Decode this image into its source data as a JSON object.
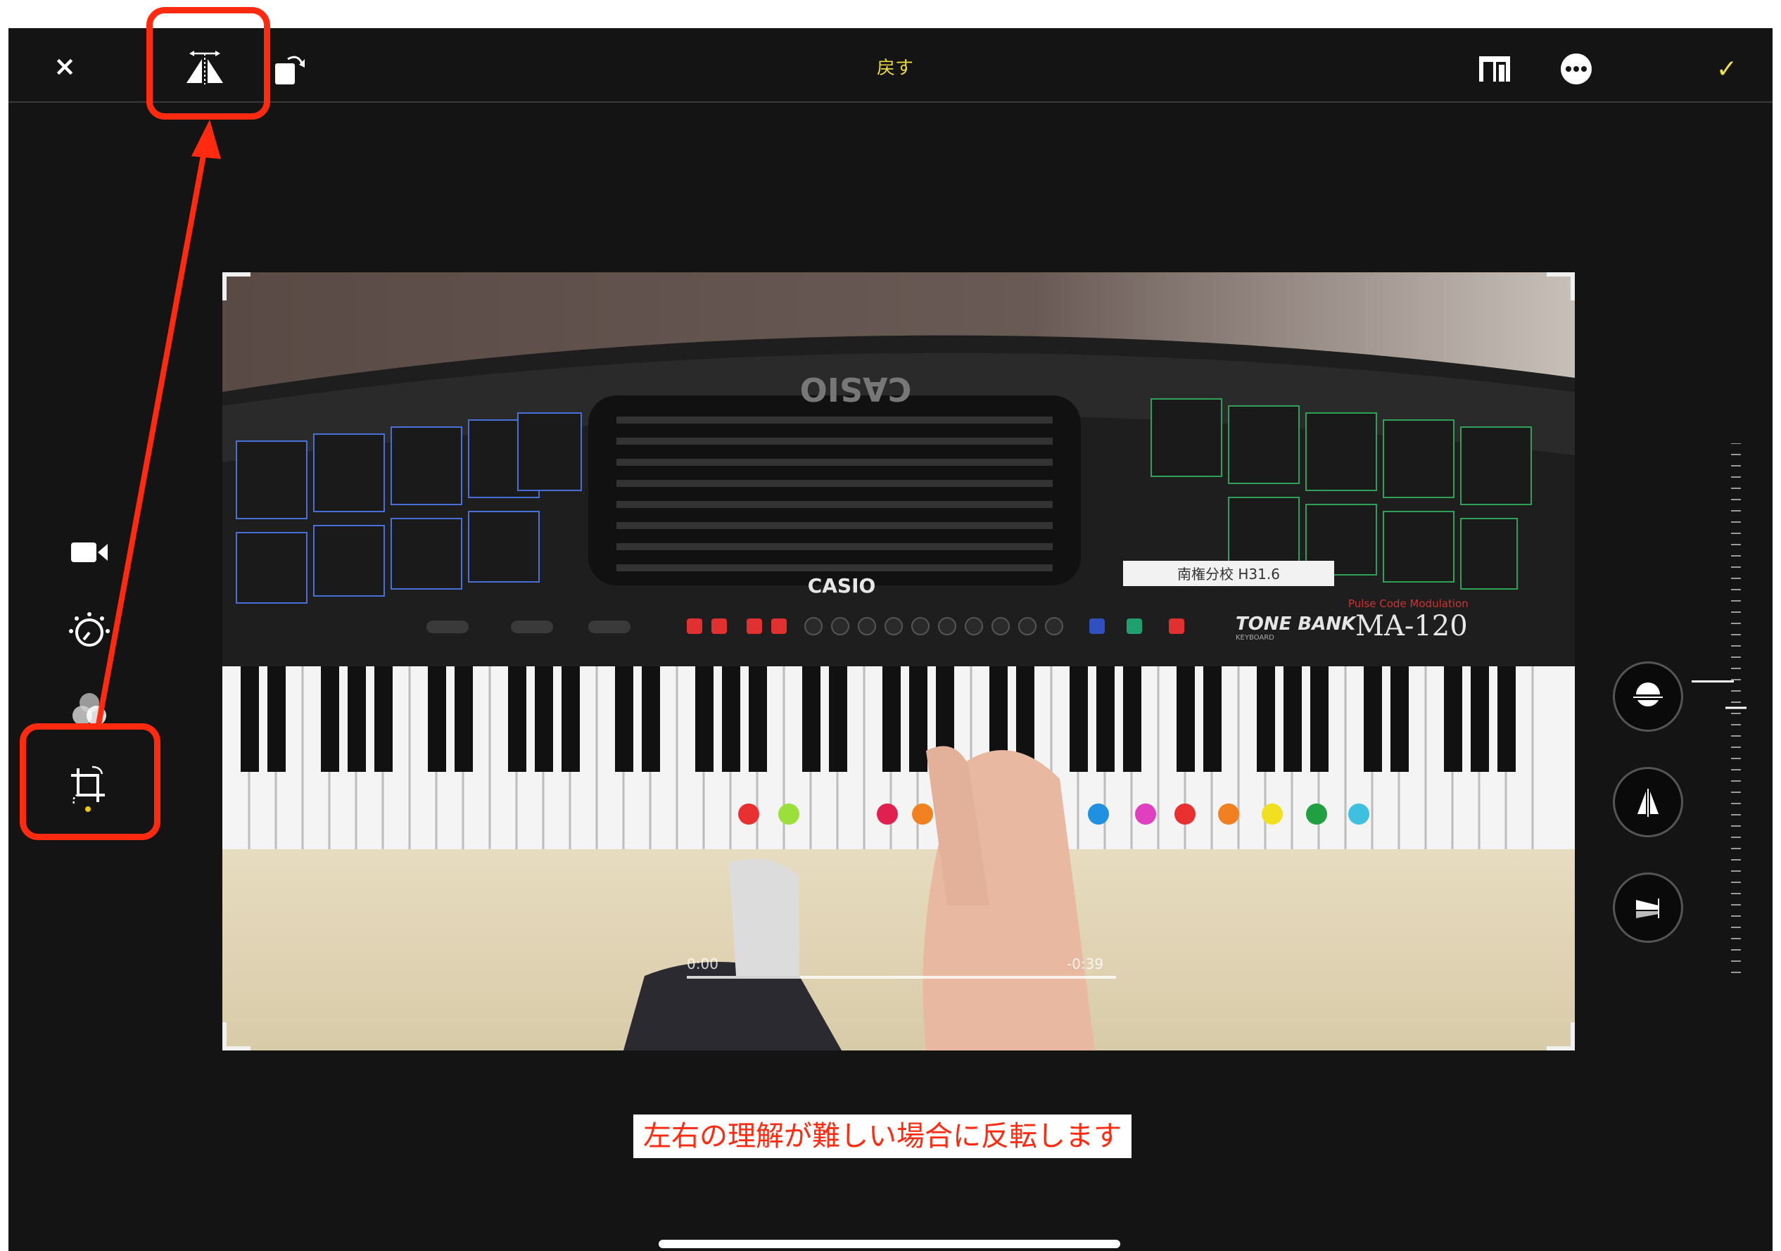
{
  "toolbar": {
    "close_icon": "×",
    "undo_label": "戻す",
    "done_icon": "✓",
    "icons": [
      "close-icon",
      "flip-horizontal-icon",
      "rotate-icon",
      "aspect-ratio-icon",
      "more-icon",
      "checkmark-icon"
    ]
  },
  "sidebar": {
    "items": [
      {
        "name": "video",
        "icon": "video-camera-icon"
      },
      {
        "name": "adjust",
        "icon": "adjust-dial-icon"
      },
      {
        "name": "filters",
        "icon": "filters-icon"
      },
      {
        "name": "crop",
        "icon": "crop-rotate-icon",
        "selected": true
      }
    ]
  },
  "photo": {
    "keyboard_brand": "CASIO",
    "keyboard_model": "MA-120",
    "keyboard_series": "TONE BANK",
    "keyboard_sub": "KEYBOARD",
    "logo_mirrored": "CASIO",
    "pcm_text": "Pulse Code Modulation",
    "label_tape": "南権分校 H31.6",
    "scrub_time_left": "0:00",
    "scrub_time_right": "-0:39"
  },
  "tilt": {
    "buttons": [
      "straighten-icon",
      "vertical-perspective-icon",
      "horizontal-perspective-icon"
    ]
  },
  "annotation": {
    "caption": "左右の理解が難しい場合に反転します",
    "highlight_color": "#ff2a0f"
  },
  "colors": {
    "accent_yellow": "#f0e048",
    "background": "#141414"
  }
}
